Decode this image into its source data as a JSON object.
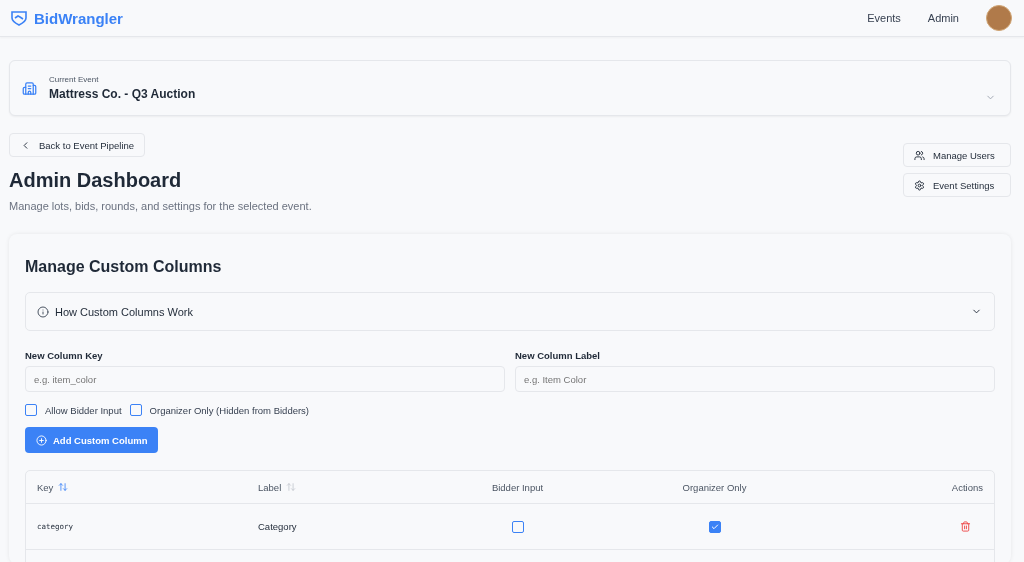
{
  "header": {
    "brand": "BidWrangler",
    "nav": [
      "Events",
      "Admin"
    ]
  },
  "event_selector": {
    "caption": "Current Event",
    "value": "Mattress Co. - Q3 Auction"
  },
  "back_button": "Back to Event Pipeline",
  "page": {
    "title": "Admin Dashboard",
    "subtitle": "Manage lots, bids, rounds, and settings for the selected event."
  },
  "side_buttons": [
    {
      "kind": "users",
      "label": "Manage Users"
    },
    {
      "kind": "settings",
      "label": "Event Settings"
    }
  ],
  "section": {
    "title": "Manage Custom Columns",
    "accordion": {
      "title": "How Custom Columns Work",
      "expanded": false
    },
    "fields": [
      {
        "label": "New Column Key",
        "placeholder": "e.g. item_color"
      },
      {
        "label": "New Column Label",
        "placeholder": "e.g. Item Color"
      }
    ],
    "options": [
      {
        "label": "Allow Bidder Input",
        "checked": false
      },
      {
        "label": "Organizer Only (Hidden from Bidders)",
        "checked": false
      }
    ],
    "add_button": "Add Custom Column"
  },
  "table": {
    "columns": [
      {
        "label": "Key",
        "kind": "sortable",
        "sort_active": true
      },
      {
        "label": "Label",
        "kind": "sortable",
        "sort_active": false
      },
      {
        "label": "Bidder Input",
        "kind": "center"
      },
      {
        "label": "Organizer Only",
        "kind": "center"
      },
      {
        "label": "Actions",
        "kind": "right"
      }
    ],
    "rows": [
      {
        "key": "category",
        "label": "Category",
        "bidder_input": false,
        "organizer_only": true
      }
    ]
  }
}
